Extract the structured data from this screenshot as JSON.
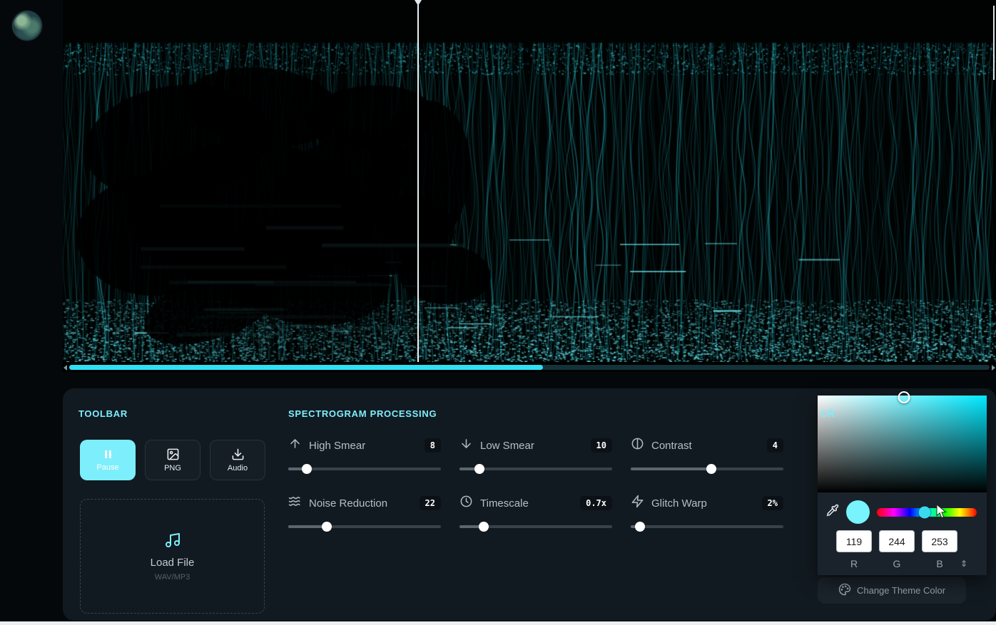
{
  "theme": {
    "accent": "#7deefc",
    "page_bg": "#05080a",
    "panel_bg": "#121a21"
  },
  "spectrogram": {
    "playhead_pct": 38,
    "scrollbar": {
      "filled_pct": 51.5
    }
  },
  "toolbar": {
    "heading": "TOOLBAR",
    "buttons": [
      {
        "label": "Pause",
        "icon": "pause-icon",
        "active": true
      },
      {
        "label": "PNG",
        "icon": "image-icon",
        "active": false
      },
      {
        "label": "Audio",
        "icon": "download-icon",
        "active": false
      }
    ],
    "load_file": {
      "label": "Load File",
      "sublabel": "WAV/MP3",
      "icon": "music-note-icon"
    }
  },
  "processing": {
    "heading": "SPECTROGRAM PROCESSING",
    "sliders": [
      {
        "label": "High Smear",
        "value": "8",
        "pct": 12,
        "icon": "arrow-up-icon"
      },
      {
        "label": "Low Smear",
        "value": "10",
        "pct": 13,
        "icon": "arrow-down-icon"
      },
      {
        "label": "Contrast",
        "value": "4",
        "pct": 53,
        "icon": "contrast-icon"
      },
      {
        "label": "Noise Reduction",
        "value": "22",
        "pct": 25,
        "icon": "waves-icon"
      },
      {
        "label": "Timescale",
        "value": "0.7x",
        "pct": 16,
        "icon": "clock-icon"
      },
      {
        "label": "Glitch Warp",
        "value": "2%",
        "pct": 6,
        "icon": "bolt-icon"
      }
    ]
  },
  "right_panel": {
    "heading_visible": "CR",
    "theme_button": {
      "label": "Change Theme Color",
      "icon": "palette-icon"
    }
  },
  "color_picker": {
    "r": "119",
    "g": "244",
    "b": "253",
    "labels": {
      "r": "R",
      "g": "G",
      "b": "B"
    },
    "selected_hex": "#77f4fd",
    "hue_thumb_pct": 48,
    "sat_cursor_left_pct": 51
  },
  "icons": {
    "pause": "❚❚",
    "image": "▣",
    "download": "⤓",
    "music_note": "♫",
    "arrow_up": "↑",
    "arrow_down": "↓",
    "contrast": "◑",
    "waves": "≋",
    "clock": "◷",
    "bolt": "⚡",
    "eyedropper": "⤝",
    "palette": "🎨",
    "scroll_left": "◀",
    "scroll_right": "▶",
    "rgb_mode_toggle": "⇕"
  }
}
